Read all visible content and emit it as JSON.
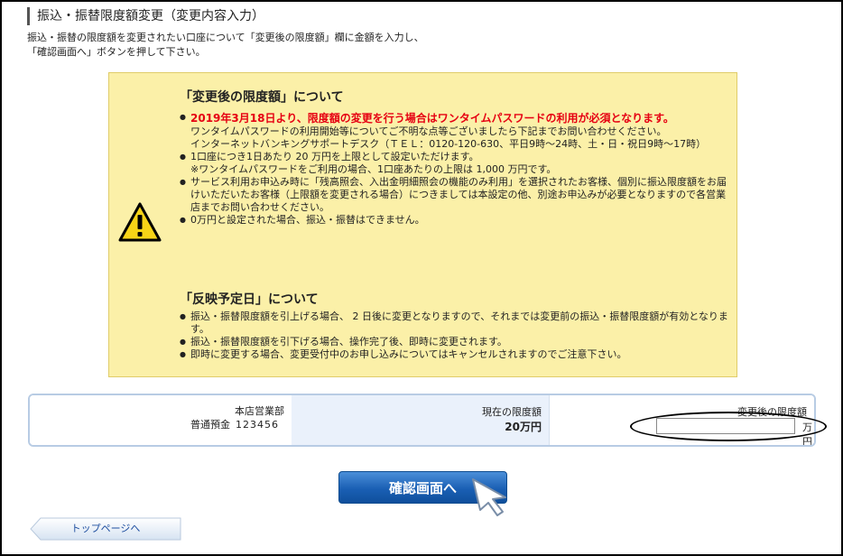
{
  "header": {
    "title": "振込・振替限度額変更（変更内容入力）",
    "intro_line1": "振込・振替の限度額を変更されたい口座について「変更後の限度額」欄に金額を入力し、",
    "intro_line2": "「確認画面へ」ボタンを押して下さい。"
  },
  "notice": {
    "icon": "warning-triangle-icon",
    "section1_title": "「変更後の限度額」について",
    "section1_items": [
      "2019年3月18日より、限度額の変更を行う場合はワンタイムパスワードの利用が必須となります。",
      "1口座につき1日あたり 20 万円を上限として設定いただけます。",
      "サービス利用お申込み時に「残高照会、入出金明細照会の機能のみ利用」を選択されたお客様、個別に振込限度額をお届けいただいたお客様（上限額を変更される場合）につきましては本設定の他、別途お申込みが必要となりますので各営業店までお問い合わせください。",
      "0万円と設定された場合、振込・振替はできません。"
    ],
    "section1_item1_sub1": "ワンタイムパスワードの利用開始等についてご不明な点等ございましたら下記までお問い合わせください。",
    "section1_item1_sub2": "インターネットバンキングサポートデスク（ＴＥＬ：0120-120-630、平日9時～24時、土・日・祝日9時～17時）",
    "section1_item2_sub": "※ワンタイムパスワードをご利用の場合、1口座あたりの上限は 1,000 万円です。",
    "section2_title": "「反映予定日」について",
    "section2_items": [
      "振込・振替限度額を引上げる場合、 2 日後に変更となりますので、それまでは変更前の振込・振替限度額が有効となります。",
      "振込・振替限度額を引下げる場合、操作完了後、即時に変更されます。",
      "即時に変更する場合、変更受付中のお申し込みについてはキャンセルされますのでご注意下さい。"
    ]
  },
  "account": {
    "branch": "本店営業部",
    "type": "普通預金",
    "number": "123456",
    "current_label": "現在の限度額",
    "current_value": "20万円",
    "new_label": "変更後の限度額",
    "new_value": "",
    "unit": "万円"
  },
  "actions": {
    "confirm_label": "確認画面へ",
    "top_link_label": "トップページへ"
  },
  "colors": {
    "notice_bg": "#fbf0a8",
    "warning_text": "#e60012",
    "button_blue": "#1a5fb4",
    "account_border": "#b8cce4"
  }
}
